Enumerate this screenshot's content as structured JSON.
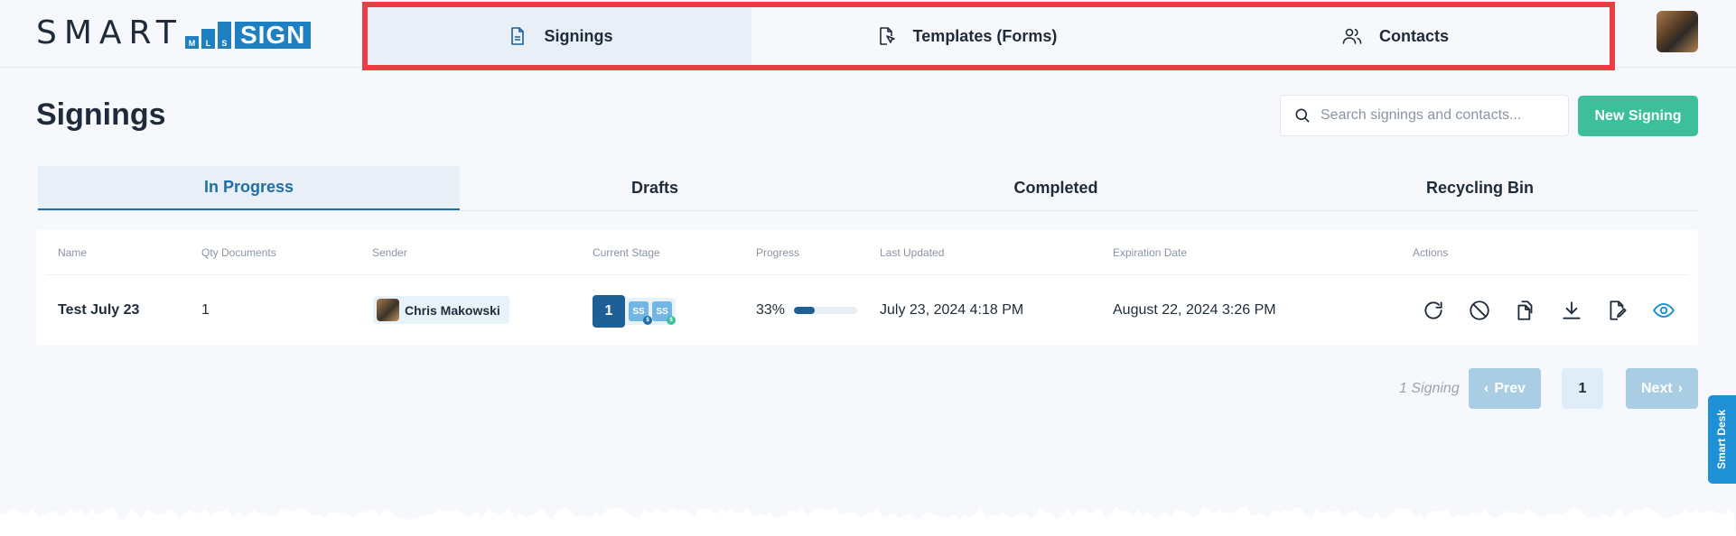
{
  "header": {
    "logo": {
      "smart": "SMART",
      "mls": [
        "M",
        "L",
        "S"
      ],
      "sign": "SIGN"
    },
    "nav": [
      {
        "label": "Signings",
        "icon": "document-icon",
        "active": true
      },
      {
        "label": "Templates (Forms)",
        "icon": "document-pointer-icon",
        "active": false
      },
      {
        "label": "Contacts",
        "icon": "users-icon",
        "active": false
      }
    ],
    "highlight_color": "#ea3e45"
  },
  "page": {
    "title": "Signings",
    "search_placeholder": "Search signings and contacts...",
    "new_button": "New Signing"
  },
  "tabs": [
    {
      "label": "In Progress",
      "active": true
    },
    {
      "label": "Drafts",
      "active": false
    },
    {
      "label": "Completed",
      "active": false
    },
    {
      "label": "Recycling Bin",
      "active": false
    }
  ],
  "table": {
    "columns": [
      "Name",
      "Qty Documents",
      "Sender",
      "Current Stage",
      "Progress",
      "Last Updated",
      "Expiration Date",
      "Actions"
    ],
    "rows": [
      {
        "name": "Test July 23",
        "qty": "1",
        "sender": "Chris Makowski",
        "stage": "1",
        "signers": [
          {
            "initials": "SS",
            "dot_color": "#1e6fa6"
          },
          {
            "initials": "SS",
            "dot_color": "#3cbf9a"
          }
        ],
        "progress_label": "33%",
        "progress_value": 33,
        "last_updated": "July 23, 2024 4:18 PM",
        "expiration": "August 22, 2024 3:26 PM",
        "actions": [
          "refresh-icon",
          "cancel-icon",
          "copy-document-icon",
          "download-icon",
          "edit-document-icon",
          "view-icon"
        ]
      }
    ]
  },
  "pagination": {
    "count": "1 Signing",
    "prev": "Prev",
    "page": "1",
    "next": "Next"
  },
  "side_tab": "Smart Desk",
  "colors": {
    "accent": "#1e6fa6",
    "green": "#3cbf9a",
    "brand_blue": "#1e7fc1"
  }
}
